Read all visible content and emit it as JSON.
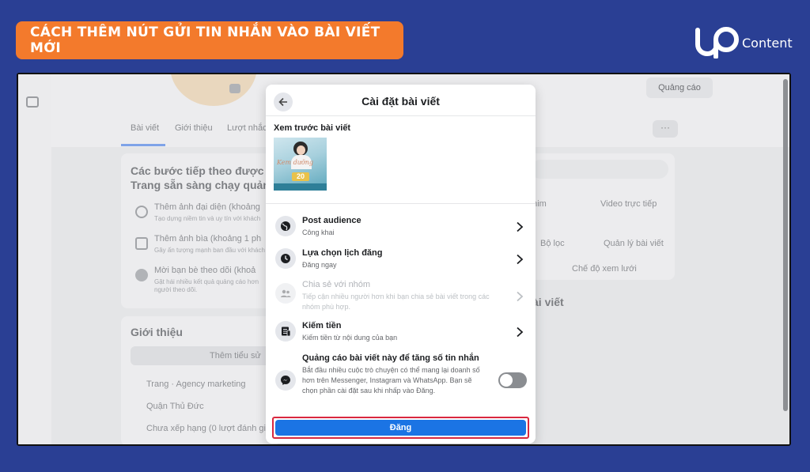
{
  "banner": {
    "title": "CÁCH THÊM NÚT GỬI TIN NHẮN VÀO BÀI VIẾT MỚI"
  },
  "logo": {
    "text": "Content"
  },
  "background_page": {
    "ads_button": "Quảng cáo",
    "tabs": [
      "Bài viết",
      "Giới thiệu",
      "Lượt nhắc"
    ],
    "steps_title_line1": "Các bước tiếp theo được đ",
    "steps_title_line2": "Trang sẵn sàng chạy quảng",
    "steps": [
      {
        "label": "Thêm ảnh đại diện (khoảng",
        "sub": "Tạo dựng niềm tin và uy tín với khách"
      },
      {
        "label": "Thêm ảnh bìa (khoảng 1 ph",
        "sub": "Gây ấn tượng mạnh ban đầu với khách"
      },
      {
        "label": "Mời bạn bè theo dõi (khoả",
        "sub": "Gặt hái nhiều kết quả quảng cáo hơn"
      }
    ],
    "steps_sub_extra": "người theo dõi.",
    "about_title": "Giới thiệu",
    "add_bio": "Thêm tiểu sử",
    "about_items": [
      "Trang · Agency marketing",
      "Quận Thủ Đức",
      "Chưa xếp hạng (0 lượt đánh giá)"
    ],
    "right_live_video": "Video trực tiếp",
    "right_reels": "phim",
    "right_filter": "Bộ lọc",
    "right_manage": "Quản lý bài viết",
    "right_grid": "Chế độ xem lưới",
    "right_posts": "ài viết"
  },
  "dialog": {
    "title": "Cài đặt bài viết",
    "preview_label": "Xem trước bài viết",
    "thumb_script": "Kem dưỡng",
    "thumb_number": "20",
    "options": [
      {
        "title": "Post audience",
        "subtitle": "Công khai",
        "icon": "globe-icon"
      },
      {
        "title": "Lựa chọn lịch đăng",
        "subtitle": "Đăng ngay",
        "icon": "clock-icon"
      },
      {
        "title": "Chia sẻ với nhóm",
        "subtitle": "Tiếp cận nhiều người hơn khi bạn chia sẻ bài viết trong các nhóm phù hợp.",
        "icon": "group-icon"
      },
      {
        "title": "Kiếm tiền",
        "subtitle": "Kiếm tiền từ nội dung của bạn",
        "icon": "monetize-icon"
      },
      {
        "title": "Quảng cáo bài viết này để tăng số tin nhắn",
        "subtitle": "Bắt đầu nhiều cuộc trò chuyện có thể mang lại doanh số hơn trên Messenger, Instagram và WhatsApp. Bạn sẽ chọn phần cài đặt sau khi nhấp vào Đăng.",
        "icon": "messenger-icon"
      }
    ],
    "toggle_on": false,
    "post_button": "Đăng"
  },
  "colors": {
    "banner": "#f37a2c",
    "background": "#2a3f94",
    "primary_button": "#1b74e4",
    "highlight_border": "#d9283f"
  }
}
